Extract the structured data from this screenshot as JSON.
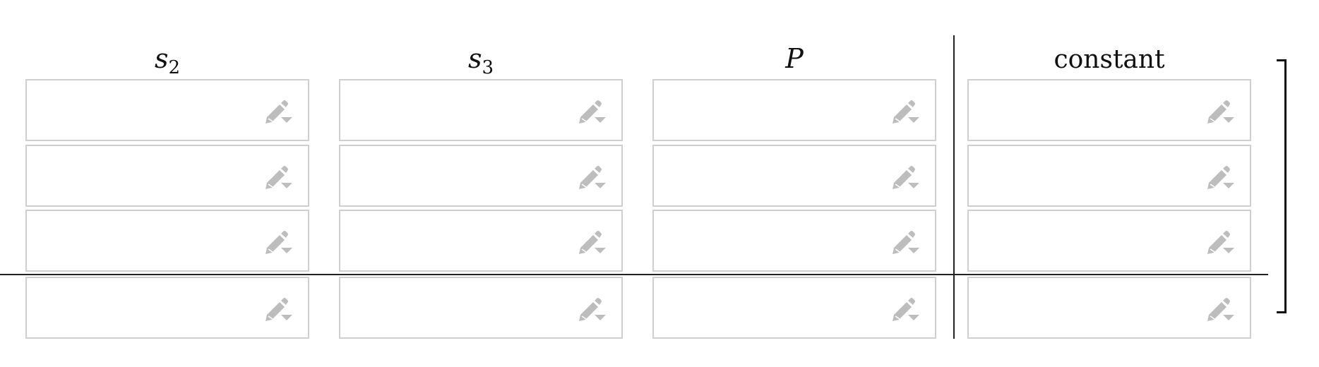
{
  "matrix": {
    "columns": [
      {
        "var": "s",
        "sub": "2",
        "plain": ""
      },
      {
        "var": "s",
        "sub": "3",
        "plain": ""
      },
      {
        "var": "P",
        "sub": "",
        "plain": ""
      },
      {
        "var": "",
        "sub": "",
        "plain": "constant"
      }
    ],
    "rows": [
      [
        "",
        "",
        "",
        ""
      ],
      [
        "",
        "",
        "",
        ""
      ],
      [
        "",
        "",
        "",
        ""
      ],
      [
        "",
        "",
        "",
        ""
      ]
    ]
  },
  "icons": {
    "cell_edit": "pencil-dropdown-icon"
  },
  "colors": {
    "cell_border": "#cfcfcf",
    "icon": "#bdbdbd",
    "rule": "#222222"
  }
}
